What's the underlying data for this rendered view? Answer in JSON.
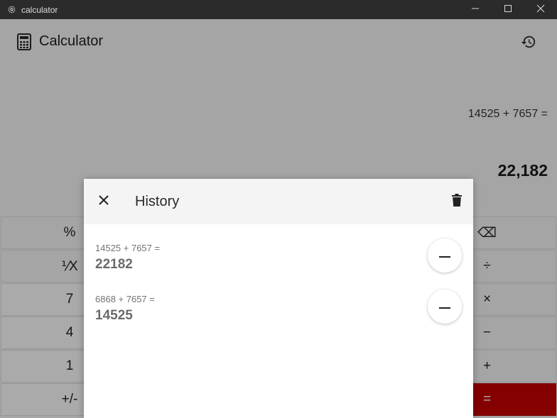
{
  "window": {
    "title": "calculator",
    "controls": {
      "minimize": "minimize-icon",
      "maximize": "maximize-icon",
      "close": "close-icon"
    }
  },
  "header": {
    "title": "Calculator",
    "icon": "calculator-icon",
    "history_icon": "history-icon"
  },
  "display": {
    "expression": "14525 + 7657 =",
    "result": "22,182"
  },
  "keypad": {
    "rows": [
      [
        {
          "label": "%"
        },
        {
          "label": "⌫"
        }
      ],
      [
        {
          "label": "⅟X"
        },
        {
          "label": "÷"
        }
      ],
      [
        {
          "label": "7"
        },
        {
          "label": "×"
        }
      ],
      [
        {
          "label": "4"
        },
        {
          "label": "−"
        }
      ],
      [
        {
          "label": "1"
        },
        {
          "label": "+"
        }
      ],
      [
        {
          "label": "+/-"
        },
        {
          "label": "="
        }
      ]
    ]
  },
  "history": {
    "title": "History",
    "close_icon": "close-icon",
    "delete_icon": "trash-icon",
    "items": [
      {
        "expression": "14525 + 7657 =",
        "result": "22182"
      },
      {
        "expression": "6868 + 7657 =",
        "result": "14525"
      }
    ]
  },
  "colors": {
    "equals_button": "#c40000",
    "titlebar": "#2b2b2b"
  }
}
